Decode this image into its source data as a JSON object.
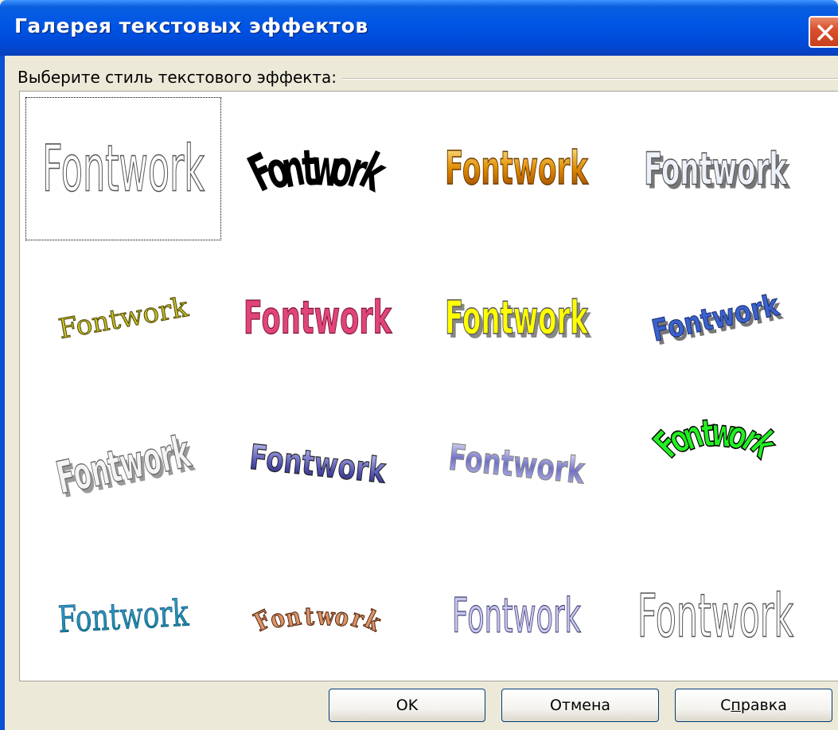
{
  "window": {
    "title": "Галерея текстовых эффектов"
  },
  "group": {
    "label": "Выберите стиль текстового эффекта:"
  },
  "gallery": {
    "sample_text": "Fontwork",
    "selected_index": 0,
    "items": [
      {
        "style": "outline-thin"
      },
      {
        "style": "black-arch"
      },
      {
        "style": "gold-gradient"
      },
      {
        "style": "gray-3d"
      },
      {
        "style": "olive-slant"
      },
      {
        "style": "red-perspective"
      },
      {
        "style": "yellow-shadow"
      },
      {
        "style": "blue-rising"
      },
      {
        "style": "silver-3d"
      },
      {
        "style": "blue-purple-wave"
      },
      {
        "style": "blue-silver-wave"
      },
      {
        "style": "green-arch"
      },
      {
        "style": "teal-serif"
      },
      {
        "style": "brown-arch"
      },
      {
        "style": "lavender-perspective"
      },
      {
        "style": "outline-gray"
      }
    ]
  },
  "buttons": {
    "ok": "OK",
    "cancel": "Отмена",
    "help_prefix": "С",
    "help_mnemonic": "п",
    "help_suffix": "равка"
  },
  "colors": {
    "titlebar": "#0055e5",
    "dialog_bg": "#ece9d8",
    "close": "#d9502e"
  }
}
